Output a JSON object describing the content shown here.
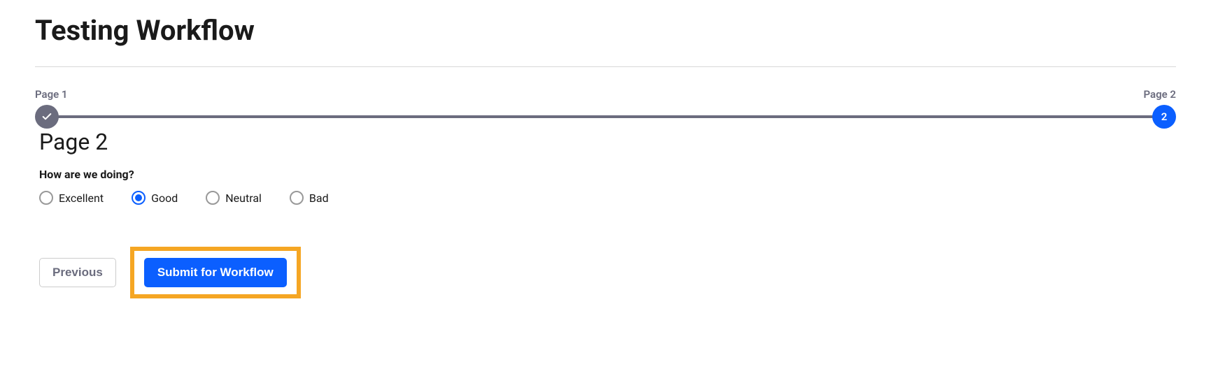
{
  "header": {
    "title": "Testing Workflow"
  },
  "stepper": {
    "step1": {
      "label": "Page 1",
      "completed": true
    },
    "step2": {
      "label": "Page 2",
      "number": "2",
      "active": true
    }
  },
  "section": {
    "title": "Page 2",
    "question": "How are we doing?"
  },
  "options": {
    "opt1": "Excellent",
    "opt2": "Good",
    "opt3": "Neutral",
    "opt4": "Bad",
    "selected": "Good"
  },
  "buttons": {
    "previous": "Previous",
    "submit": "Submit for Workflow"
  }
}
